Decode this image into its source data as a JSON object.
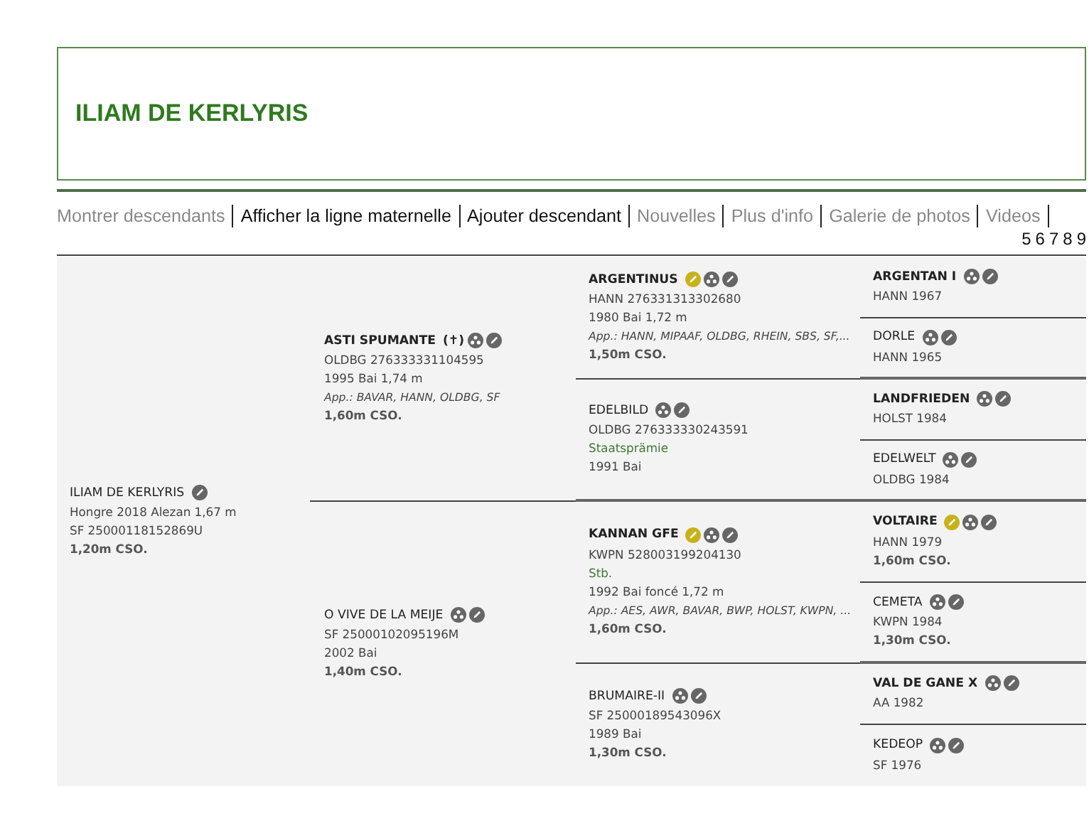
{
  "header": {
    "title": "ILIAM DE KERLYRIS"
  },
  "nav": {
    "links": [
      {
        "label": "Montrer descendants",
        "highlighted": false
      },
      {
        "label": "Afficher la ligne maternelle",
        "highlighted": true
      },
      {
        "label": "Ajouter descendant",
        "highlighted": true
      },
      {
        "label": "Nouvelles",
        "highlighted": false
      },
      {
        "label": "Plus d'info",
        "highlighted": false
      },
      {
        "label": "Galerie de photos",
        "highlighted": false
      },
      {
        "label": "Videos",
        "highlighted": false
      }
    ],
    "generations": [
      "5",
      "6",
      "7",
      "8",
      "9"
    ]
  },
  "pedigree": {
    "name": "ILIAM DE KERLYRIS",
    "male": false,
    "featured": false,
    "offspring": false,
    "editable": true,
    "lines": [
      {
        "text": "Hongre 2018 Alezan 1,67 m",
        "kind": "plain"
      },
      {
        "text": "SF 25000118152869U",
        "kind": "plain"
      },
      {
        "text": "1,20m CSO.",
        "kind": "sport"
      }
    ],
    "sire": {
      "name": "ASTI SPUMANTE",
      "male": true,
      "death_mark": "(✝)",
      "featured": false,
      "offspring": true,
      "editable": true,
      "lines": [
        {
          "text": "OLDBG 276333331104595",
          "kind": "plain"
        },
        {
          "text": "1995 Bai 1,74 m",
          "kind": "plain"
        },
        {
          "text": "App.: BAVAR, HANN, OLDBG, SF",
          "kind": "approval"
        },
        {
          "text": "1,60m CSO.",
          "kind": "sport"
        }
      ],
      "sire": {
        "name": "ARGENTINUS",
        "male": true,
        "featured": true,
        "offspring": true,
        "editable": true,
        "lines": [
          {
            "text": "HANN 276331313302680",
            "kind": "plain"
          },
          {
            "text": "1980 Bai 1,72 m",
            "kind": "plain"
          },
          {
            "text": "App.: HANN, MIPAAF, OLDBG, RHEIN, SBS, SF,...",
            "kind": "approval"
          },
          {
            "text": "1,50m CSO.",
            "kind": "sport"
          }
        ],
        "sire": {
          "name": "ARGENTAN I",
          "male": true,
          "featured": false,
          "offspring": true,
          "editable": true,
          "lines": [
            {
              "text": "HANN 1967",
              "kind": "plain"
            }
          ]
        },
        "dam": {
          "name": "DORLE",
          "male": false,
          "featured": false,
          "offspring": true,
          "editable": true,
          "lines": [
            {
              "text": "HANN 1965",
              "kind": "plain"
            }
          ]
        }
      },
      "dam": {
        "name": "EDELBILD",
        "male": false,
        "featured": false,
        "offspring": true,
        "editable": true,
        "lines": [
          {
            "text": "OLDBG 276333330243591",
            "kind": "plain"
          },
          {
            "text": "Staatsprämie",
            "kind": "premium"
          },
          {
            "text": "1991 Bai",
            "kind": "plain"
          }
        ],
        "sire": {
          "name": "LANDFRIEDEN",
          "male": true,
          "featured": false,
          "offspring": true,
          "editable": true,
          "lines": [
            {
              "text": "HOLST 1984",
              "kind": "plain"
            }
          ]
        },
        "dam": {
          "name": "EDELWELT",
          "male": false,
          "featured": false,
          "offspring": true,
          "editable": true,
          "lines": [
            {
              "text": "OLDBG 1984",
              "kind": "plain"
            }
          ]
        }
      }
    },
    "dam": {
      "name": "O VIVE DE LA MEIJE",
      "male": false,
      "featured": false,
      "offspring": true,
      "editable": true,
      "lines": [
        {
          "text": "SF 25000102095196M",
          "kind": "plain"
        },
        {
          "text": "2002 Bai",
          "kind": "plain"
        },
        {
          "text": "1,40m CSO.",
          "kind": "sport"
        }
      ],
      "sire": {
        "name": "KANNAN GFE",
        "male": true,
        "featured": true,
        "offspring": true,
        "editable": true,
        "lines": [
          {
            "text": "KWPN 528003199204130",
            "kind": "plain"
          },
          {
            "text": "Stb.",
            "kind": "premium"
          },
          {
            "text": "1992 Bai foncé 1,72 m",
            "kind": "plain"
          },
          {
            "text": "App.: AES, AWR, BAVAR, BWP, HOLST, KWPN, ...",
            "kind": "approval"
          },
          {
            "text": "1,60m CSO.",
            "kind": "sport"
          }
        ],
        "sire": {
          "name": "VOLTAIRE",
          "male": true,
          "featured": true,
          "offspring": true,
          "editable": true,
          "lines": [
            {
              "text": "HANN 1979",
              "kind": "plain"
            },
            {
              "text": "1,60m CSO.",
              "kind": "sport"
            }
          ]
        },
        "dam": {
          "name": "CEMETA",
          "male": false,
          "featured": false,
          "offspring": true,
          "editable": true,
          "lines": [
            {
              "text": "KWPN 1984",
              "kind": "plain"
            },
            {
              "text": "1,30m CSO.",
              "kind": "sport"
            }
          ]
        }
      },
      "dam": {
        "name": "BRUMAIRE-II",
        "male": false,
        "featured": false,
        "offspring": true,
        "editable": true,
        "lines": [
          {
            "text": "SF 25000189543096X",
            "kind": "plain"
          },
          {
            "text": "1989 Bai",
            "kind": "plain"
          },
          {
            "text": "1,30m CSO.",
            "kind": "sport"
          }
        ],
        "sire": {
          "name": "VAL DE GANE X",
          "male": true,
          "featured": false,
          "offspring": true,
          "editable": true,
          "lines": [
            {
              "text": "AA 1982",
              "kind": "plain"
            }
          ]
        },
        "dam": {
          "name": "KEDEOP",
          "male": false,
          "featured": false,
          "offspring": true,
          "editable": true,
          "lines": [
            {
              "text": "SF 1976",
              "kind": "plain"
            }
          ]
        }
      }
    }
  }
}
